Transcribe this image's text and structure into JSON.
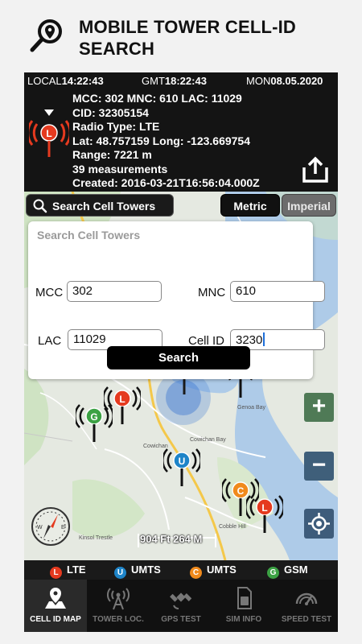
{
  "app": {
    "title_line1": "MOBILE TOWER CELL-ID",
    "title_line2": "SEARCH"
  },
  "time_bar": {
    "local_label": "LOCAL",
    "local_time": "14:22:43",
    "gmt_label": "GMT",
    "gmt_time": "18:22:43",
    "day_label": "MON",
    "date": "08.05.2020"
  },
  "cell_info": {
    "mcc_mnc_lac": "MCC: 302   MNC: 610   LAC: 11029",
    "cid": "CID: 32305154",
    "radio": "Radio Type: LTE",
    "latlong": "Lat: 48.757159   Long: -123.669754",
    "range": "Range: 7221 m",
    "measurements": "39 measurements",
    "created": "Created: 2016-03-21T16:56:04.000Z"
  },
  "map_toolbar": {
    "search_label": "Search Cell Towers",
    "metric": "Metric",
    "imperial": "Imperial"
  },
  "search_form": {
    "heading": "Search Cell Towers",
    "mcc_label": "MCC",
    "mcc_value": "302",
    "mnc_label": "MNC",
    "mnc_value": "610",
    "lac_label": "LAC",
    "lac_value": "11029",
    "cellid_label": "Cell ID",
    "cellid_value": "3230",
    "submit": "Search"
  },
  "map": {
    "zoom_in": "+",
    "zoom_out": "−",
    "scale": "904 Ft 264 M",
    "places": {
      "genoa_bay": "Genoa Bay",
      "cowichan": "Cowichan",
      "cowichan_bay": "Cowichan Bay",
      "cobble_hill": "Cobble Hill",
      "kinsol": "Kinsol Trestle"
    }
  },
  "legend": [
    {
      "letter": "L",
      "label": "LTE",
      "color": "#e53a1f"
    },
    {
      "letter": "U",
      "label": "UMTS",
      "color": "#1e84c8"
    },
    {
      "letter": "C",
      "label": "UMTS",
      "color": "#f08a1c"
    },
    {
      "letter": "G",
      "label": "GSM",
      "color": "#3ca244"
    }
  ],
  "tabs": [
    {
      "label": "CELL ID MAP",
      "icon": "map-pin-icon"
    },
    {
      "label": "TOWER LOC.",
      "icon": "tower-icon"
    },
    {
      "label": "GPS TEST",
      "icon": "satellite-icon"
    },
    {
      "label": "SIM INFO",
      "icon": "sim-card-icon"
    },
    {
      "label": "SPEED TEST",
      "icon": "speedometer-icon"
    }
  ],
  "colors": {
    "lte": "#e53a1f",
    "umts_u": "#1e84c8",
    "umts_c": "#f08a1c",
    "gsm": "#3ca244",
    "caret": "#1e6fd9"
  }
}
